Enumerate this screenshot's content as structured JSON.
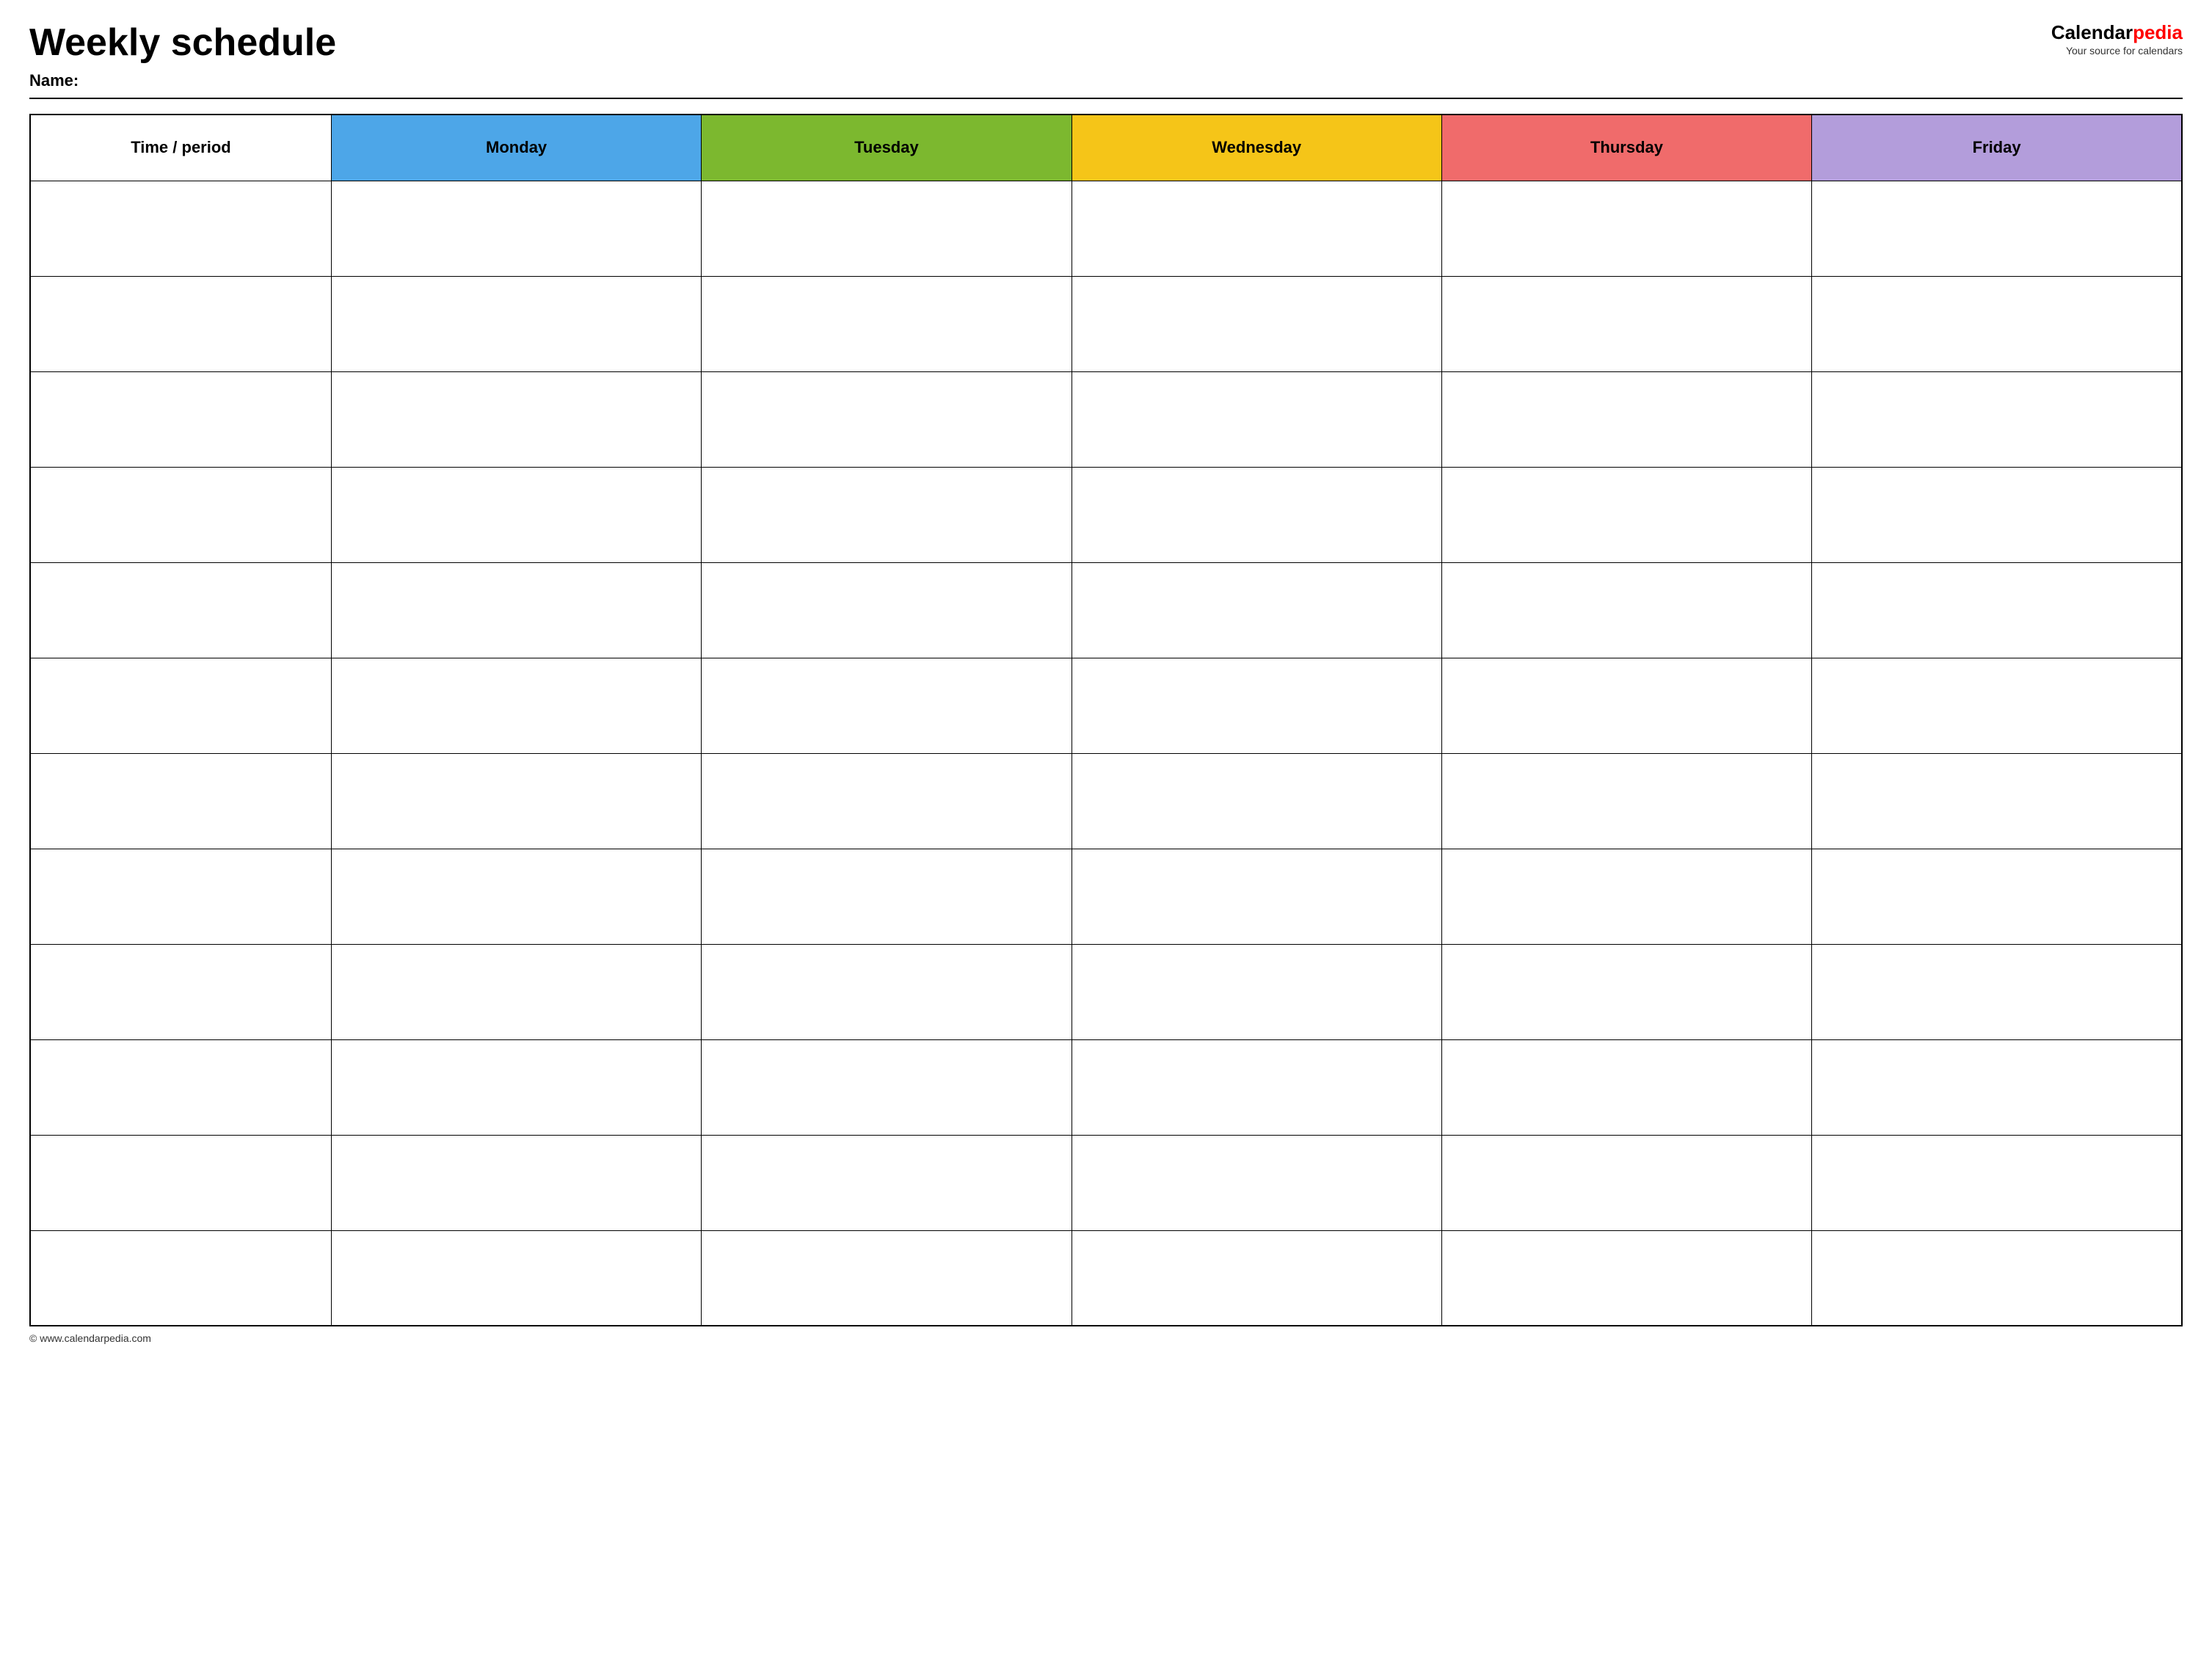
{
  "header": {
    "title": "Weekly schedule",
    "name_label": "Name:",
    "logo": {
      "brand_part1": "Calendar",
      "brand_part2": "pedia",
      "tagline": "Your source for calendars"
    }
  },
  "table": {
    "columns": [
      {
        "id": "time",
        "label": "Time / period",
        "color": "#ffffff",
        "class": "th-time"
      },
      {
        "id": "monday",
        "label": "Monday",
        "color": "#4da6e8",
        "class": "th-monday"
      },
      {
        "id": "tuesday",
        "label": "Tuesday",
        "color": "#7cb82f",
        "class": "th-tuesday"
      },
      {
        "id": "wednesday",
        "label": "Wednesday",
        "color": "#f5c518",
        "class": "th-wednesday"
      },
      {
        "id": "thursday",
        "label": "Thursday",
        "color": "#f06b6b",
        "class": "th-thursday"
      },
      {
        "id": "friday",
        "label": "Friday",
        "color": "#b39ddb",
        "class": "th-friday"
      }
    ],
    "row_count": 12
  },
  "footer": {
    "copyright": "© www.calendarpedia.com"
  }
}
